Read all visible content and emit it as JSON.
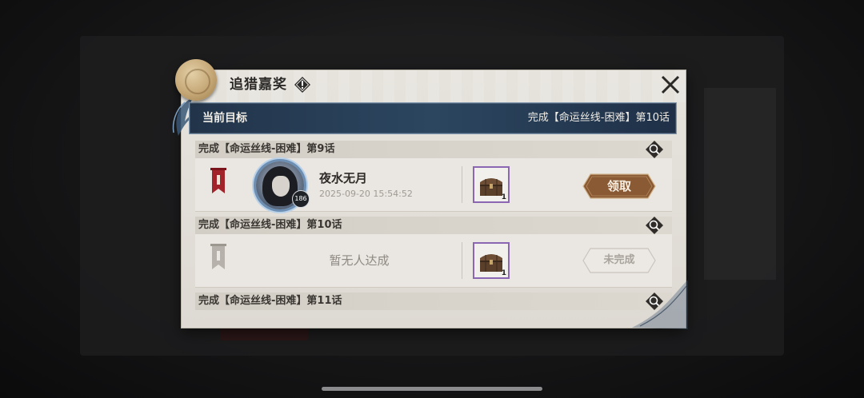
{
  "dialog": {
    "title": "追猎嘉奖",
    "close_icon": "close-icon",
    "info_icon": "info-icon"
  },
  "current_goal": {
    "label": "当前目标",
    "value": "完成【命运丝线-困难】第10话"
  },
  "sections": [
    {
      "header": "完成【命运丝线-困难】第9话",
      "status": "achieved",
      "player": {
        "name": "夜水无月",
        "level": "186",
        "time": "2025-09-20 15:54:52"
      },
      "reward": {
        "icon": "treasure-chest-icon",
        "qty": "1"
      },
      "action_label": "领取"
    },
    {
      "header": "完成【命运丝线-困难】第10话",
      "status": "not_achieved",
      "empty_text": "暂无人达成",
      "reward": {
        "icon": "treasure-chest-icon",
        "qty": "1"
      },
      "action_label": "未完成"
    },
    {
      "header": "完成【命运丝线-困难】第11话"
    }
  ],
  "colors": {
    "goal_bar": "#2c4660",
    "flag_active": "#9e1d24",
    "flag_inactive": "#b6b2ab",
    "reward_border": "#8a66b3",
    "claim_button": "#8a5a35"
  }
}
